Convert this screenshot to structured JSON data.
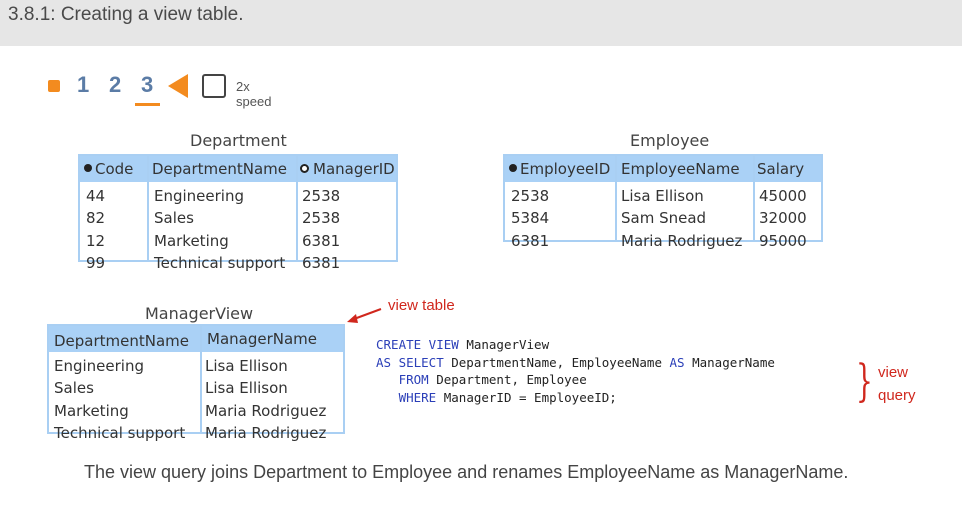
{
  "header": {
    "title": "3.8.1: Creating a view table."
  },
  "controls": {
    "steps": [
      "1",
      "2",
      "3"
    ],
    "speed_label": "2x speed",
    "active_step": 3
  },
  "department": {
    "caption": "Department",
    "headers": [
      "Code",
      "DepartmentName",
      "ManagerID"
    ],
    "rows": [
      [
        "44",
        "Engineering",
        "2538"
      ],
      [
        "82",
        "Sales",
        "2538"
      ],
      [
        "12",
        "Marketing",
        "6381"
      ],
      [
        "99",
        "Technical support",
        "6381"
      ]
    ]
  },
  "employee": {
    "caption": "Employee",
    "headers": [
      "EmployeeID",
      "EmployeeName",
      "Salary"
    ],
    "rows": [
      [
        "2538",
        "Lisa Ellison",
        "45000"
      ],
      [
        "5384",
        "Sam Snead",
        "32000"
      ],
      [
        "6381",
        "Maria Rodriguez",
        "95000"
      ]
    ]
  },
  "managerview": {
    "caption": "ManagerView",
    "headers": [
      "DepartmentName",
      "ManagerName"
    ],
    "rows": [
      [
        "Engineering",
        "Lisa Ellison"
      ],
      [
        "Sales",
        "Lisa Ellison"
      ],
      [
        "Marketing",
        "Maria Rodriguez"
      ],
      [
        "Technical support",
        "Maria Rodriguez"
      ]
    ]
  },
  "sql": {
    "l1_kw": "CREATE VIEW",
    "l1_rest": " ManagerView",
    "l2_kw1": "AS SELECT",
    "l2_mid": " DepartmentName, EmployeeName ",
    "l2_kw2": "AS",
    "l2_rest": " ManagerName",
    "l3_kw": "FROM",
    "l3_rest": " Department, Employee",
    "l4_kw": "WHERE",
    "l4_rest": " ManagerID = EmployeeID;"
  },
  "annotations": {
    "view_table": "view table",
    "view_query_1": "view",
    "view_query_2": "query",
    "accent_color": "#d0271d"
  },
  "caption": "The view query joins Department to Employee and renames EmployeeName as ManagerName."
}
